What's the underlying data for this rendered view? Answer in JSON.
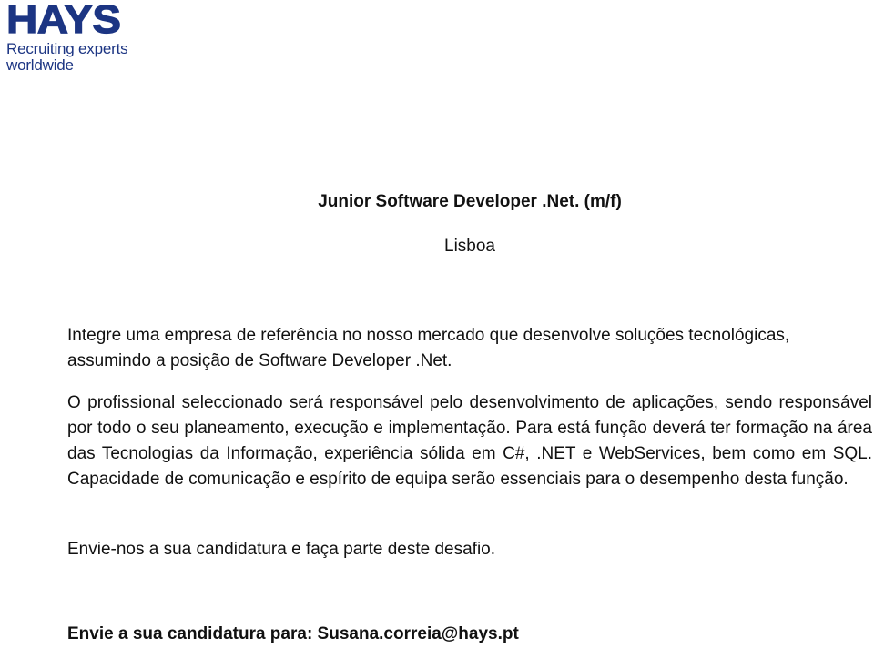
{
  "logo": {
    "brand": "HAYS",
    "tagline_line1": "Recruiting experts",
    "tagline_line2": "worldwide",
    "color": "#1c3583"
  },
  "job": {
    "title": "Junior Software Developer .Net. (m/f)",
    "location": "Lisboa"
  },
  "body": {
    "paragraph1": "Integre uma empresa de referência no nosso mercado que desenvolve soluções tecnológicas, assumindo a posição de Software Developer .Net.",
    "paragraph2": "O profissional seleccionado será responsável pelo desenvolvimento de aplicações, sendo responsável por todo o seu planeamento, execução e implementação. Para está função deverá ter formação na área das Tecnologias da Informação, experiência sólida em C#, .NET e WebServices, bem como em SQL. Capacidade de comunicação e espírito de equipa serão essenciais para o desempenho desta função.",
    "paragraph3": "Envie-nos a sua candidatura e faça parte deste desafio."
  },
  "cta": {
    "label": "Envie a sua candidatura para: ",
    "email": "Susana.correia@hays.pt"
  }
}
